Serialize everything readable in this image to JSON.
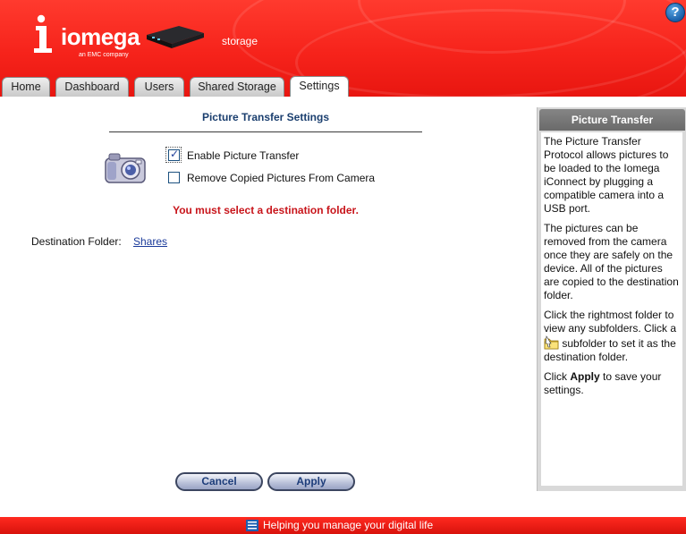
{
  "header": {
    "brand": "iomega",
    "brand_sub": "an EMC company",
    "device_name": "storage",
    "help_label": "?"
  },
  "tabs": [
    {
      "label": "Home",
      "active": false
    },
    {
      "label": "Dashboard",
      "active": false
    },
    {
      "label": "Users",
      "active": false
    },
    {
      "label": "Shared Storage",
      "active": false
    },
    {
      "label": "Settings",
      "active": true
    }
  ],
  "main": {
    "title": "Picture Transfer Settings",
    "options": [
      {
        "label": "Enable Picture Transfer",
        "checked": true
      },
      {
        "label": "Remove Copied Pictures From Camera",
        "checked": false
      }
    ],
    "error": "You must select a destination folder.",
    "destination_label": "Destination Folder:",
    "destination_link": "Shares",
    "cancel_label": "Cancel",
    "apply_label": "Apply"
  },
  "side": {
    "title": "Picture Transfer",
    "p1": "The Picture Transfer Protocol allows pictures to be loaded to the Iomega iConnect by plugging a compatible camera into a USB port.",
    "p2": "The pictures can be removed from the camera once they are safely on the device. All of the pictures are copied to the destination folder.",
    "p3_a": "Click the rightmost folder to view any subfolders. Click a",
    "p3_b": "subfolder to set it as the destination folder.",
    "p4_a": "Click",
    "p4_bold": "Apply",
    "p4_b": "to save your settings."
  },
  "footer": {
    "tagline": "Helping you manage your digital life"
  },
  "colors": {
    "brand_red": "#f6231b",
    "error_red": "#c8151b",
    "title_blue": "#1b3f6f",
    "link_blue": "#1a3a9a"
  }
}
